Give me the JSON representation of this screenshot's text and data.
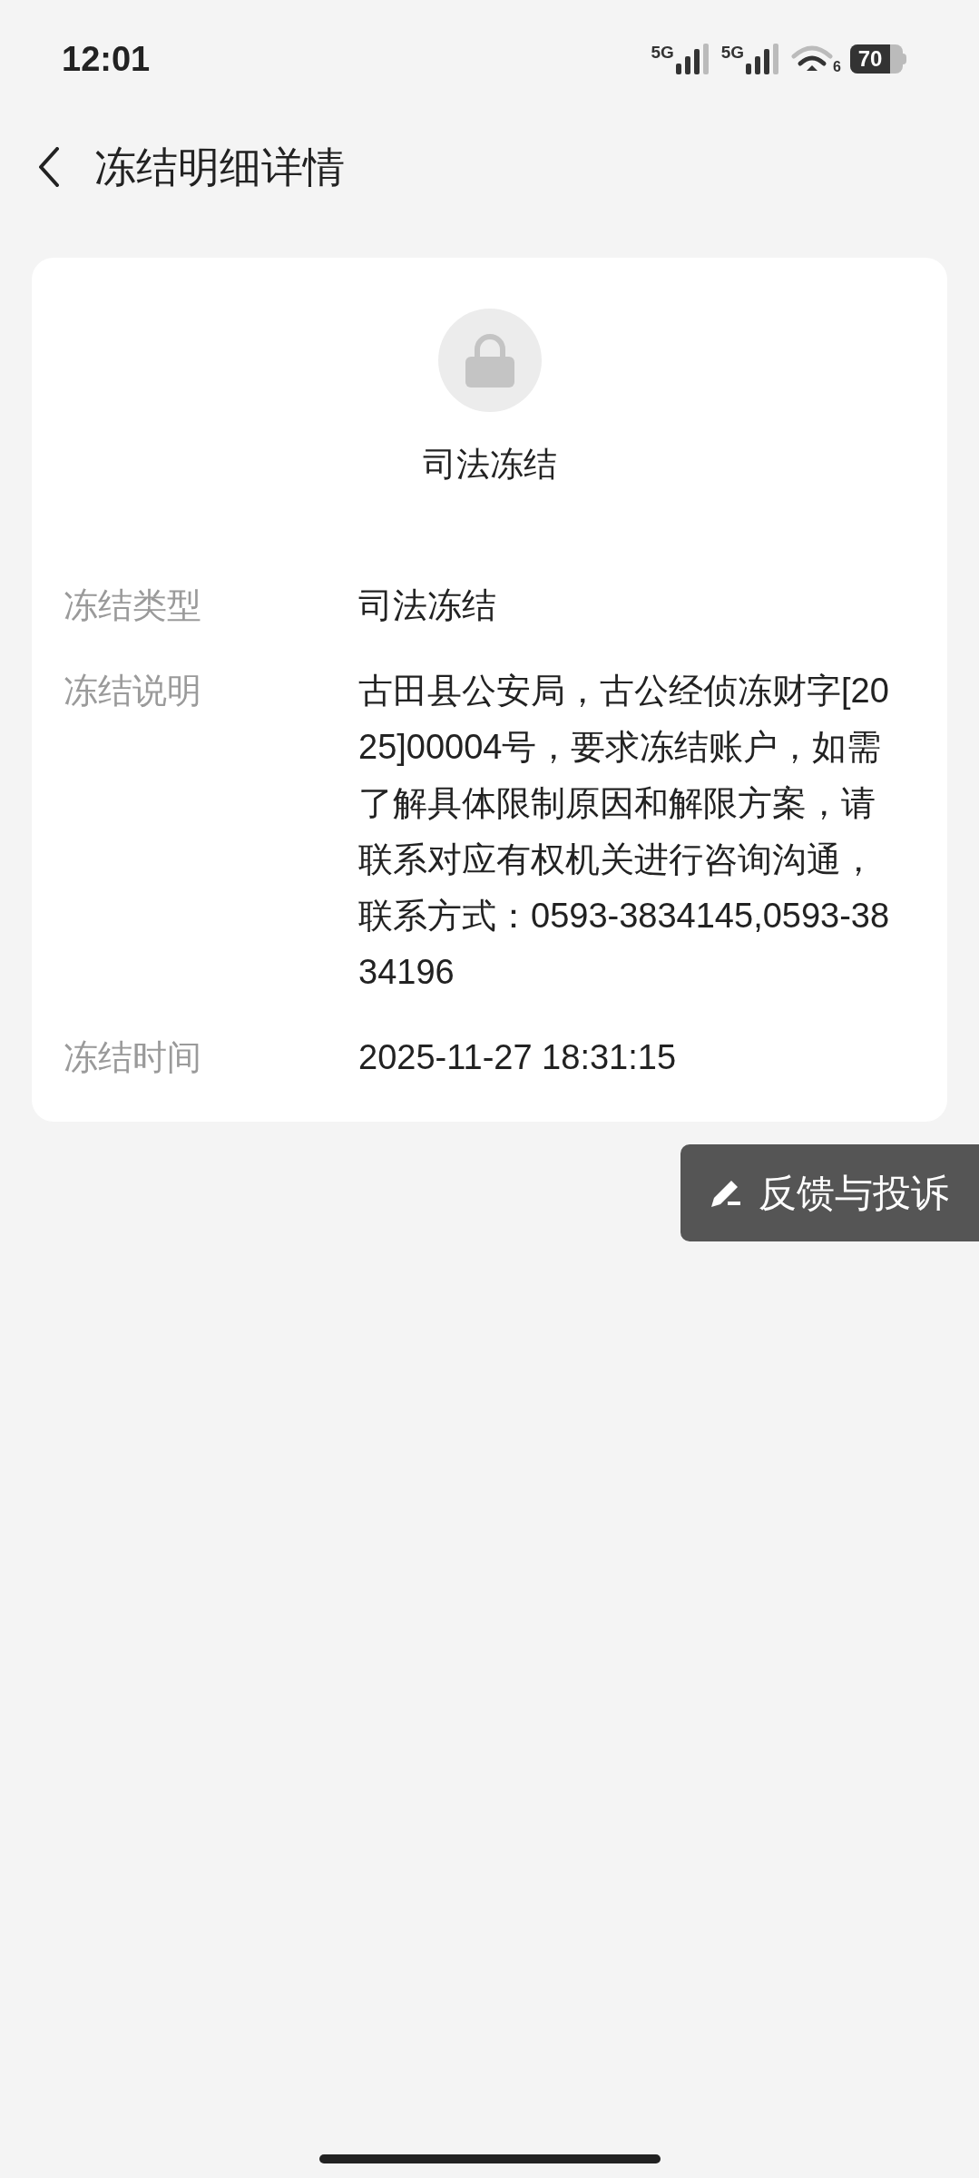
{
  "status_bar": {
    "time": "12:01",
    "networks": [
      "5G",
      "5G"
    ],
    "wifi_badge": "6",
    "battery": "70"
  },
  "header": {
    "title": "冻结明细详情"
  },
  "card": {
    "status": "司法冻结",
    "rows": [
      {
        "label": "冻结类型",
        "value": "司法冻结"
      },
      {
        "label": "冻结说明",
        "value": "古田县公安局，古公经侦冻财字[2025]00004号，要求冻结账户，如需了解具体限制原因和解限方案，请联系对应有权机关进行咨询沟通，联系方式：0593-3834145,0593-3834196"
      },
      {
        "label": "冻结时间",
        "value": "2025-11-27 18:31:15"
      }
    ]
  },
  "feedback_button": {
    "label": "反馈与投诉"
  }
}
